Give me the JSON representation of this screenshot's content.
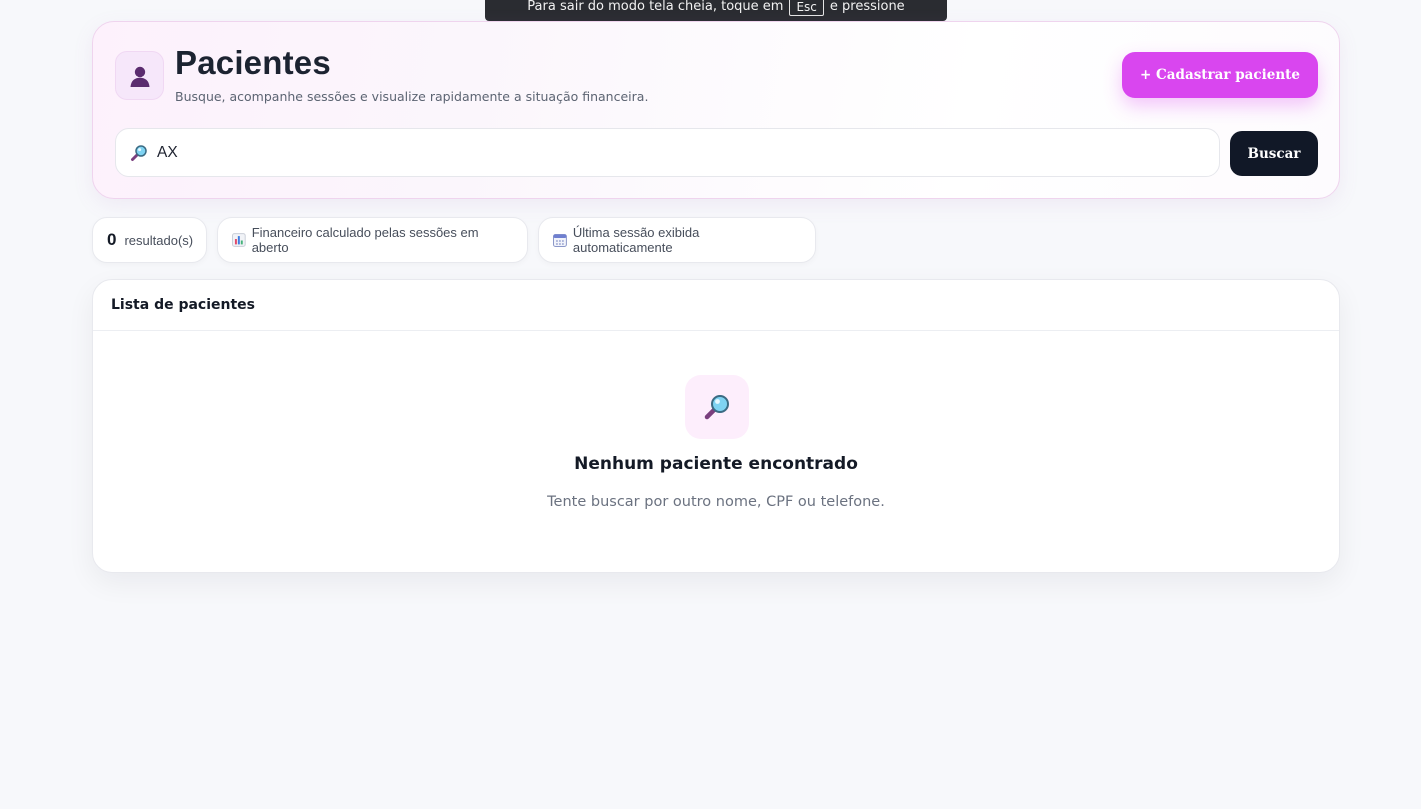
{
  "fullscreen_notice": {
    "text_before": "Para sair do modo tela cheia, toque em",
    "key": "Esc",
    "text_after": "e pressione"
  },
  "header": {
    "avatar_icon": "person-icon",
    "title": "Pacientes",
    "subtitle": "Busque, acompanhe sessões e visualize rapidamente a situação financeira.",
    "add_button_label": "+ Cadastrar paciente",
    "accent_color": "#d946ef"
  },
  "search": {
    "icon": "magnifier-icon",
    "value": "AX",
    "button_label": "Buscar"
  },
  "stats": {
    "count": "0",
    "count_label": "resultado(s)",
    "financial_icon": "bar-chart-icon",
    "financial_text": "Financeiro calculado pelas sessões em aberto",
    "session_icon": "calendar-icon",
    "session_text": "Última sessão exibida automaticamente"
  },
  "list": {
    "title": "Lista de pacientes",
    "empty_icon": "magnifier-icon",
    "empty_title": "Nenhum paciente encontrado",
    "empty_text": "Tente buscar por outro nome, CPF ou telefone."
  }
}
